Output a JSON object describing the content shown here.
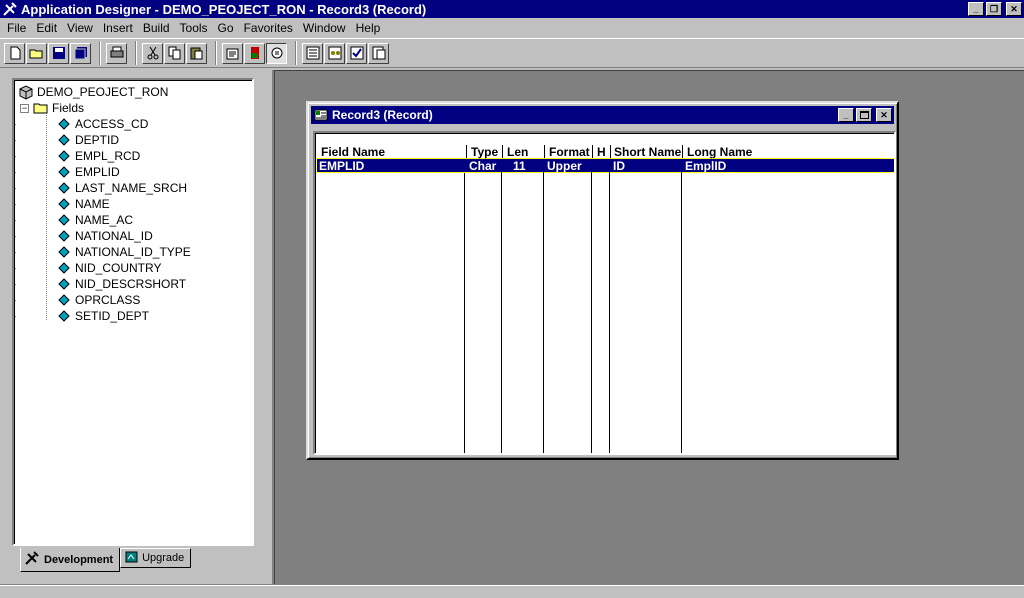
{
  "window": {
    "title": "Application Designer - DEMO_PEOJECT_RON - Record3 (Record)",
    "minimize": "_",
    "restore": "❐",
    "close": "✕"
  },
  "menubar": {
    "items": [
      "File",
      "Edit",
      "View",
      "Insert",
      "Build",
      "Tools",
      "Go",
      "Favorites",
      "Window",
      "Help"
    ]
  },
  "toolbar": {
    "buttons": [
      "new-icon",
      "open-icon",
      "save-icon",
      "save-all-icon",
      "print-icon",
      "cut-icon",
      "copy-icon",
      "paste-icon",
      "properties-icon",
      "build-icon",
      "project-workspace-icon",
      "record-fields-icon",
      "definition-icon",
      "validate-icon",
      "find-references-icon"
    ]
  },
  "project": {
    "root_label": "DEMO_PEOJECT_RON",
    "folder_label": "Fields",
    "fields": [
      "ACCESS_CD",
      "DEPTID",
      "EMPL_RCD",
      "EMPLID",
      "LAST_NAME_SRCH",
      "NAME",
      "NAME_AC",
      "NATIONAL_ID",
      "NATIONAL_ID_TYPE",
      "NID_COUNTRY",
      "NID_DESCRSHORT",
      "OPRCLASS",
      "SETID_DEPT"
    ],
    "tabs": [
      "Development",
      "Upgrade"
    ]
  },
  "record_window": {
    "title": "Record3 (Record)",
    "columns": [
      "Field Name",
      "Type",
      "Len",
      "Format",
      "H",
      "Short Name",
      "Long Name"
    ],
    "rows": [
      {
        "field_name": "EMPLID",
        "type": "Char",
        "len": "11",
        "format": "Upper",
        "h": "",
        "short_name": "ID",
        "long_name": "EmplID"
      }
    ]
  },
  "colors": {
    "title_active": "#000080",
    "face": "#c0c0c0",
    "mdi_background": "#808080",
    "selection": "#000080"
  }
}
